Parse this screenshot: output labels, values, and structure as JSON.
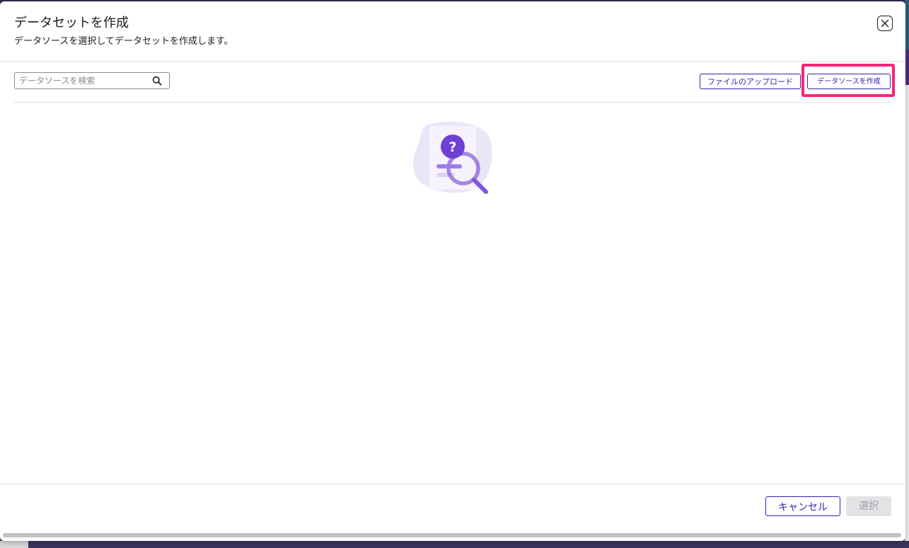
{
  "dialog": {
    "title": "データセットを作成",
    "subtitle": "データソースを選択してデータセットを作成します。",
    "close_icon": "close-icon"
  },
  "toolbar": {
    "search": {
      "placeholder": "データソースを検索",
      "value": "",
      "icon": "search-icon"
    },
    "upload_button": "ファイルのアップロード",
    "create_datasource_button": "データソースを作成"
  },
  "empty_state": {
    "icon": "empty-search-illustration"
  },
  "footer": {
    "cancel_button": "キャンセル",
    "select_button": "選択",
    "select_enabled": false
  },
  "colors": {
    "accent": "#3d1ea8",
    "highlight": "#f2267a",
    "illustration_primary": "#6f3fd6",
    "illustration_light": "#e4ddf6"
  }
}
